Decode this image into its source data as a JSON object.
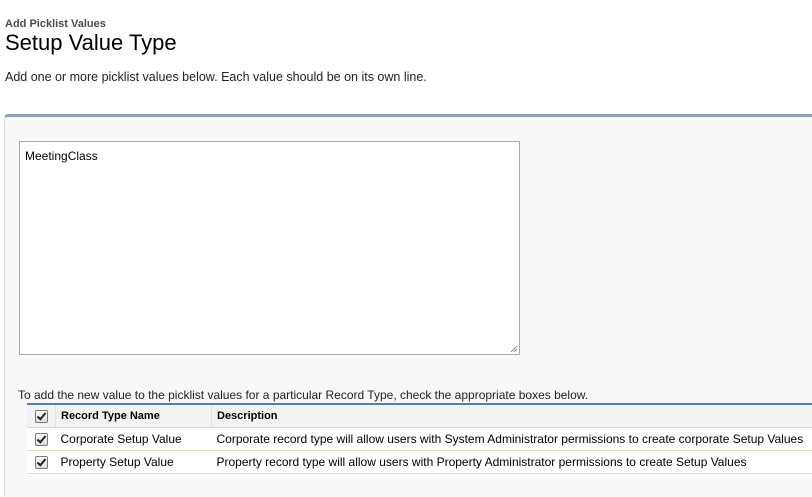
{
  "header": {
    "breadcrumb": "Add Picklist Values",
    "title": "Setup Value Type"
  },
  "intro_text": "Add one or more picklist values below. Each value should be on its own line.",
  "values_input": {
    "value": "MeetingClass"
  },
  "record_types": {
    "note": "To add the new value to the picklist values for a particular Record Type, check the appropriate boxes below.",
    "columns": [
      "Record Type Name",
      "Description"
    ],
    "select_all_checked": true,
    "rows": [
      {
        "checked": true,
        "name": "Corporate Setup Value",
        "description": "Corporate record type will allow users with System Administrator permissions to create corporate Setup Values"
      },
      {
        "checked": true,
        "name": "Property Setup Value",
        "description": "Property record type will allow users with Property Administrator permissions to create Setup Values"
      }
    ]
  }
}
